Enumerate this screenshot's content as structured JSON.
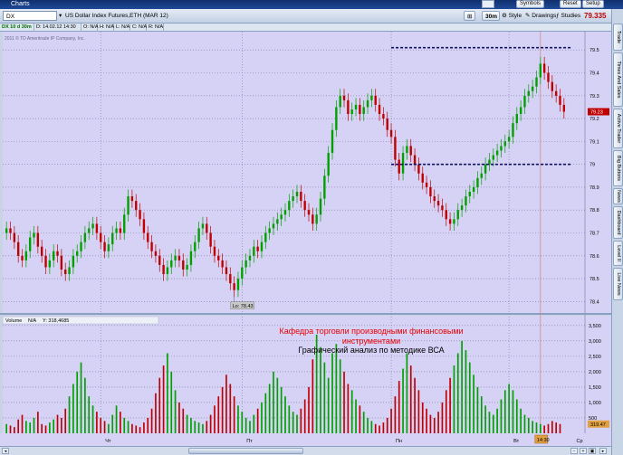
{
  "window": {
    "title": "Charts"
  },
  "toolbar": {
    "symbol": "DX",
    "symbol_description": "US Dollar Index Futures,ETH (MAR 12)",
    "timeframe": "30m",
    "style_label": "Style",
    "drawings_label": "Drawings",
    "studies_label": "Studies",
    "symbols_label": "Symbols",
    "reset_label": "Reset",
    "setup_label": "Setup",
    "last_price": "79.335",
    "net_change": "+.16",
    "pct_change": "+0.20%",
    "up_color": "#00a000",
    "down_color": "#c00000"
  },
  "info_bar": {
    "chart_id": "DX 10 d 30m",
    "date": "D: 14.02.12 14:30",
    "open": "O: N/A",
    "high": "H: N/A",
    "low": "L: N/A",
    "close": "C: N/A",
    "range": "R: N/A"
  },
  "copyright": "2011 © TD Ameritrade IP Company, Inc.",
  "side_tabs": [
    "Trade",
    "Times And Sales",
    "Active Trader",
    "Big Buttons",
    "News",
    "Dashboard",
    "Level II",
    "Live News"
  ],
  "price_chart": {
    "y_ticks": [
      "79.5",
      "79.4",
      "79.3",
      "79.2",
      "79.1",
      "79",
      "78.9",
      "78.8",
      "78.7",
      "78.6",
      "78.5",
      "78.4"
    ],
    "low_label": "Lo: 78.43",
    "last_price_badge": "79.23",
    "background": "#d6d2f5"
  },
  "volume_panel": {
    "label": "Volume",
    "value_label": "N/A",
    "extra_label": "Y: 318,4685",
    "y_ticks": [
      "3,500",
      "3,000",
      "2,500",
      "2,000",
      "1,500",
      "1,000",
      "500"
    ],
    "last_volume_badge": "319.47"
  },
  "time_axis": {
    "labels": [
      "Чт",
      "Пт",
      "Пн",
      "Вт",
      "Ср"
    ],
    "cursor_time": "14:30"
  },
  "overlay_text": {
    "line1": "Кафедра торговли производными финансовыми",
    "line2": "инструментами",
    "line3": "Графический анализ по методике ВСА"
  },
  "chart_data": [
    {
      "type": "candlestick",
      "title": "DX 10 d 30m",
      "ylim": [
        78.35,
        79.58
      ],
      "y_ticks": [
        78.4,
        78.5,
        78.6,
        78.7,
        78.8,
        78.9,
        79.0,
        79.1,
        79.2,
        79.3,
        79.4,
        79.5
      ],
      "x_session_labels": [
        "Чт",
        "Пт",
        "Пн",
        "Вт",
        "Ср"
      ],
      "annotations": [
        {
          "type": "horizontal_dashed_line",
          "y": 79.51
        },
        {
          "type": "horizontal_dashed_line",
          "y": 79.0
        },
        {
          "type": "label",
          "text": "Lo: 78.43",
          "y": 78.43
        }
      ],
      "series": [
        {
          "values": [
            78.72,
            78.7,
            78.66,
            78.6,
            78.58,
            78.62,
            78.68,
            78.7,
            78.64,
            78.6,
            78.55,
            78.58,
            78.62,
            78.6,
            78.54,
            78.52,
            78.55,
            78.6,
            78.62,
            78.66,
            78.7,
            78.72,
            78.74,
            78.7,
            78.66,
            78.62,
            78.65,
            78.7,
            78.72,
            78.7,
            78.78,
            78.86,
            78.84,
            78.8,
            78.76,
            78.7,
            78.66,
            78.62,
            78.6,
            78.56,
            78.52,
            78.55,
            78.58,
            78.6,
            78.58,
            78.54,
            78.56,
            78.62,
            78.66,
            78.72,
            78.74,
            78.7,
            78.64,
            78.6,
            78.58,
            78.55,
            78.52,
            78.48,
            78.45,
            78.5,
            78.55,
            78.58,
            78.6,
            78.64,
            78.62,
            78.66,
            78.7,
            78.72,
            78.74,
            78.76,
            78.78,
            78.8,
            78.84,
            78.86,
            78.88,
            78.84,
            78.8,
            78.78,
            78.74,
            78.78,
            78.85,
            78.95,
            79.05,
            79.15,
            79.25,
            79.3,
            79.28,
            79.22,
            79.24,
            79.26,
            79.22,
            79.25,
            79.28,
            79.3,
            79.26,
            79.22,
            79.2,
            79.15,
            79.12,
            79.02,
            78.96,
            79.05,
            79.08,
            79.04,
            79.0,
            78.96,
            78.92,
            78.9,
            78.86,
            78.84,
            78.82,
            78.8,
            78.76,
            78.74,
            78.76,
            78.8,
            78.82,
            78.86,
            78.88,
            78.9,
            78.94,
            78.96,
            79.0,
            79.02,
            79.04,
            79.06,
            79.08,
            79.1,
            79.12,
            79.18,
            79.22,
            79.25,
            79.3,
            79.32,
            79.34,
            79.38,
            79.44,
            79.4,
            79.36,
            79.32,
            79.3,
            79.26,
            79.23
          ]
        }
      ]
    },
    {
      "type": "bar",
      "title": "Volume",
      "ylim": [
        0,
        3700
      ],
      "y_ticks": [
        500,
        1000,
        1500,
        2000,
        2500,
        3000,
        3500
      ],
      "series": [
        {
          "values": [
            300,
            250,
            200,
            450,
            600,
            400,
            350,
            500,
            700,
            300,
            250,
            350,
            450,
            600,
            500,
            800,
            1200,
            1600,
            2000,
            2300,
            1800,
            1200,
            900,
            700,
            500,
            400,
            300,
            600,
            900,
            700,
            500,
            400,
            300,
            250,
            200,
            350,
            500,
            800,
            1300,
            1800,
            2200,
            2600,
            2000,
            1400,
            1000,
            800,
            600,
            500,
            400,
            350,
            300,
            400,
            600,
            900,
            1200,
            1500,
            1900,
            1600,
            1200,
            900,
            700,
            500,
            400,
            600,
            800,
            1000,
            1300,
            1600,
            2000,
            1800,
            1500,
            1200,
            900,
            700,
            600,
            800,
            1100,
            1500,
            2400,
            3200,
            2800,
            2300,
            1800,
            2600,
            2900,
            2400,
            2000,
            1600,
            1400,
            1100,
            900,
            700,
            500,
            400,
            300,
            250,
            350,
            500,
            800,
            1200,
            1700,
            2100,
            2600,
            2200,
            1800,
            1400,
            1000,
            800,
            600,
            500,
            700,
            1000,
            1400,
            1800,
            2200,
            2600,
            3000,
            2700,
            2300,
            1900,
            1500,
            1200,
            900,
            700,
            600,
            800,
            1100,
            1400,
            1600,
            1400,
            1100,
            800,
            600,
            500,
            400,
            350,
            300,
            250,
            300,
            400,
            350,
            300
          ]
        }
      ]
    }
  ]
}
